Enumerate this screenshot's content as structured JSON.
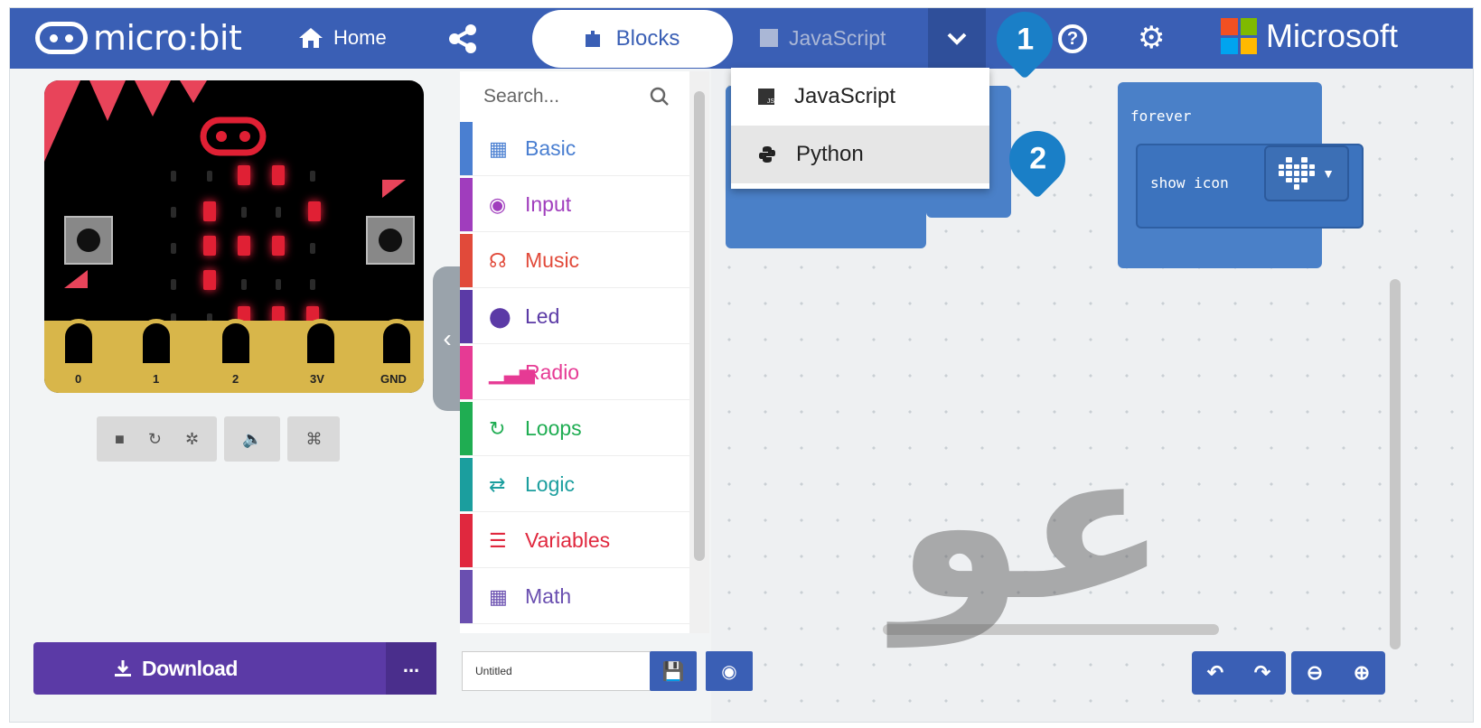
{
  "topbar": {
    "brand": "micro:bit",
    "home_label": "Home",
    "tab_blocks_label": "Blocks",
    "tab_javascript_label": "JavaScript",
    "microsoft_label": "Microsoft"
  },
  "dropdown": {
    "items": [
      {
        "label": "JavaScript",
        "icon": "javascript-icon"
      },
      {
        "label": "Python",
        "icon": "python-icon"
      }
    ]
  },
  "callouts": {
    "one": "1",
    "two": "2"
  },
  "simulator": {
    "pins": [
      "0",
      "1",
      "2",
      "3V",
      "GND"
    ]
  },
  "toolbox": {
    "search_placeholder": "Search...",
    "categories": [
      {
        "label": "Basic",
        "color": "#4a7fd1",
        "icon": "grid-icon"
      },
      {
        "label": "Input",
        "color": "#a03dbd",
        "icon": "radio-button-icon"
      },
      {
        "label": "Music",
        "color": "#e14a3a",
        "icon": "headphones-icon"
      },
      {
        "label": "Led",
        "color": "#5b3aa6",
        "icon": "toggle-icon"
      },
      {
        "label": "Radio",
        "color": "#e63a94",
        "icon": "signal-bars-icon"
      },
      {
        "label": "Loops",
        "color": "#1fad52",
        "icon": "loop-icon"
      },
      {
        "label": "Logic",
        "color": "#1b9e9e",
        "icon": "shuffle-icon"
      },
      {
        "label": "Variables",
        "color": "#e0283e",
        "icon": "lines-icon"
      },
      {
        "label": "Math",
        "color": "#6a4fb0",
        "icon": "calculator-icon"
      }
    ]
  },
  "workspace": {
    "forever_label": "forever",
    "show_icon_label": "show icon"
  },
  "bottom": {
    "download_label": "Download",
    "more_label": "...",
    "filename": "Untitled"
  }
}
